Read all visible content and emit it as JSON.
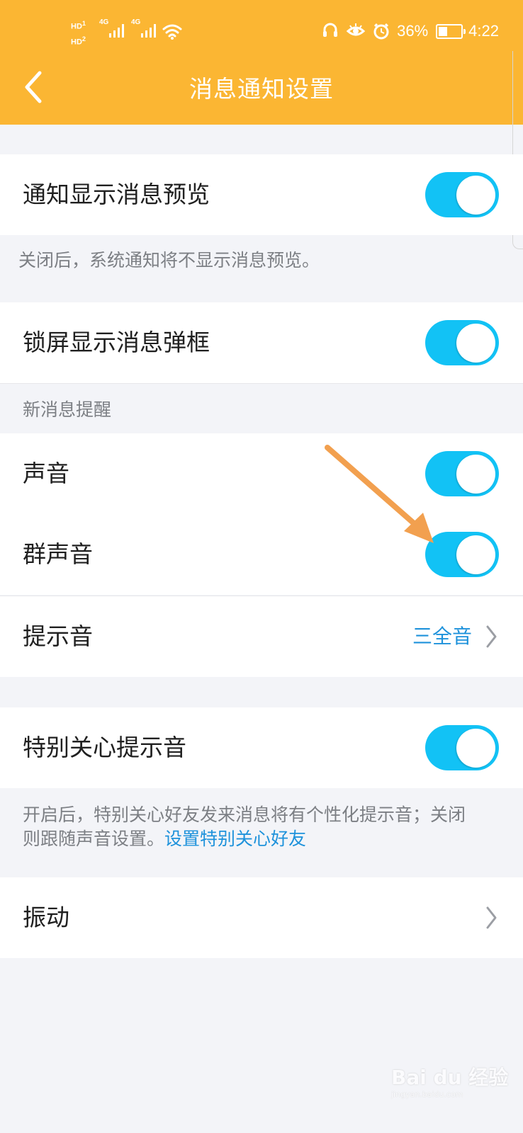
{
  "status_bar": {
    "hd1": "HD",
    "hd1_sub": "1",
    "hd2": "HD",
    "hd2_sub": "2",
    "net1": "4G",
    "net2": "4G",
    "battery_percent": "36%",
    "time": "4:22"
  },
  "header": {
    "title": "消息通知设置",
    "back_icon": "back-arrow-icon"
  },
  "settings": {
    "preview": {
      "label": "通知显示消息预览",
      "enabled": true,
      "note": "关闭后，系统通知将不显示消息预览。"
    },
    "lock_screen": {
      "label": "锁屏显示消息弹框",
      "enabled": true
    },
    "new_message_section": "新消息提醒",
    "sound": {
      "label": "声音",
      "enabled": true
    },
    "group_sound": {
      "label": "群声音",
      "enabled": true
    },
    "tone": {
      "label": "提示音",
      "value": "三全音"
    },
    "special_tone": {
      "label": "特别关心提示音",
      "enabled": true,
      "note_line1": "开启后，特别关心好友发来消息将有个性化提示音；关闭",
      "note_line2_prefix": "则跟随声音设置。",
      "note_link": "设置特别关心好友"
    },
    "vibration": {
      "label": "振动"
    }
  },
  "colors": {
    "header": "#fbb633",
    "toggle_on": "#12c2f5",
    "link": "#1e92db",
    "annotation_arrow": "#f2a04f"
  },
  "watermark": {
    "brand": "Bai du 经验",
    "url": "jingyan.baidu.com"
  }
}
